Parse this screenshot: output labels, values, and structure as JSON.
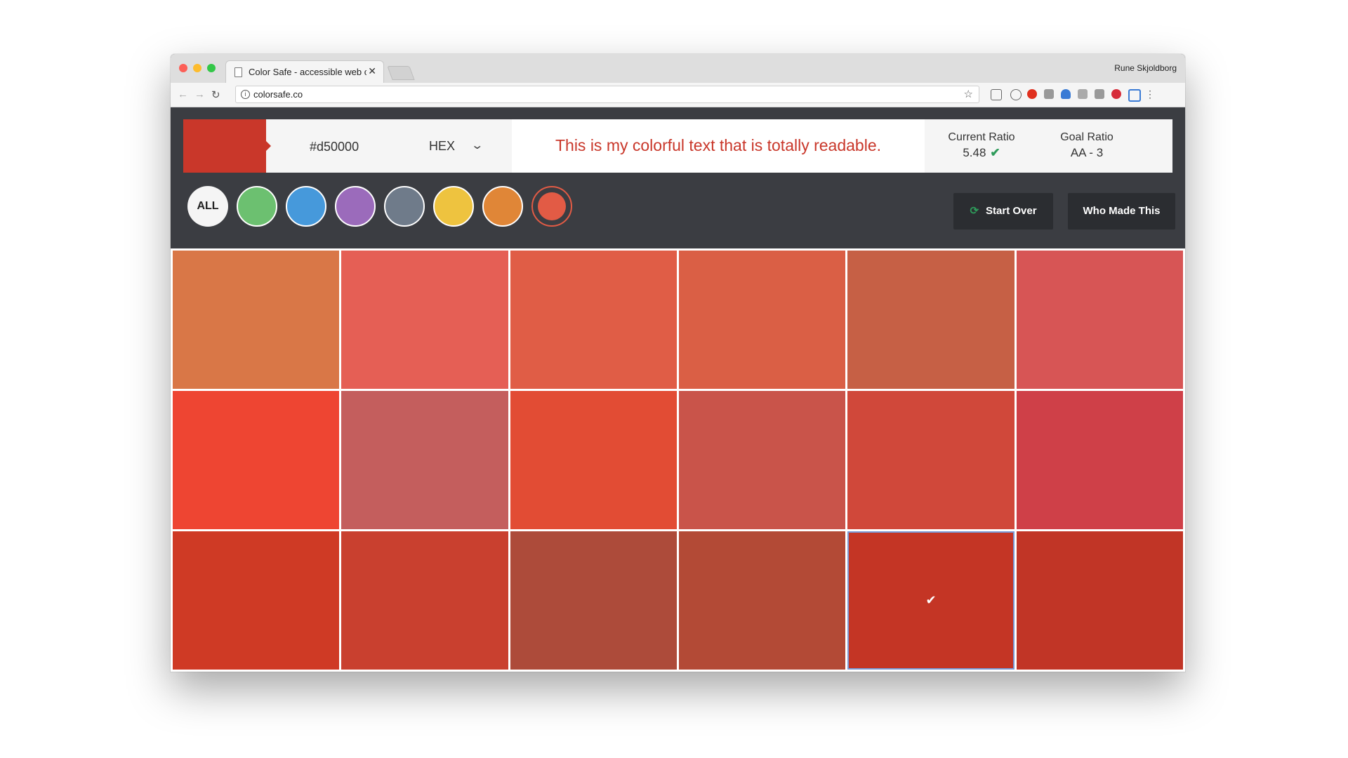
{
  "browser": {
    "tab_title": "Color Safe - accessible web c…",
    "tab_close": "✕",
    "profile_name": "Rune Skjoldborg",
    "url": "colorsafe.co",
    "traffic_lights": [
      "#fc5f57",
      "#fdbc2e",
      "#33c748"
    ]
  },
  "header": {
    "selected_color": "#c9372a",
    "hex_value": "#d50000",
    "format_label": "HEX",
    "sample_text": "This is my colorful text that is totally readable.",
    "current_ratio_label": "Current Ratio",
    "current_ratio_value": "5.48",
    "goal_ratio_label": "Goal Ratio",
    "goal_ratio_value": "AA - 3"
  },
  "filters": {
    "all_label": "ALL",
    "colors": [
      "#6cc070",
      "#4699db",
      "#9b6bbb",
      "#6f7b8a",
      "#eec33f",
      "#e08637"
    ],
    "active_color": "#e25b45"
  },
  "buttons": {
    "start_over": "Start Over",
    "who_made_this": "Who Made This"
  },
  "palette": {
    "rows": [
      [
        "#d97747",
        "#e55f55",
        "#e05d46",
        "#da5f45",
        "#c66045",
        "#d75555"
      ],
      [
        "#ee4532",
        "#c45e5d",
        "#e24c34",
        "#c9544a",
        "#d0483a",
        "#cf4048"
      ],
      [
        "#cf3a25",
        "#c9402f",
        "#ad4b3a",
        "#b34a36",
        "#c43525",
        "#c13526"
      ]
    ],
    "selected": {
      "row": 2,
      "col": 4
    },
    "selected_mark": "✔"
  }
}
